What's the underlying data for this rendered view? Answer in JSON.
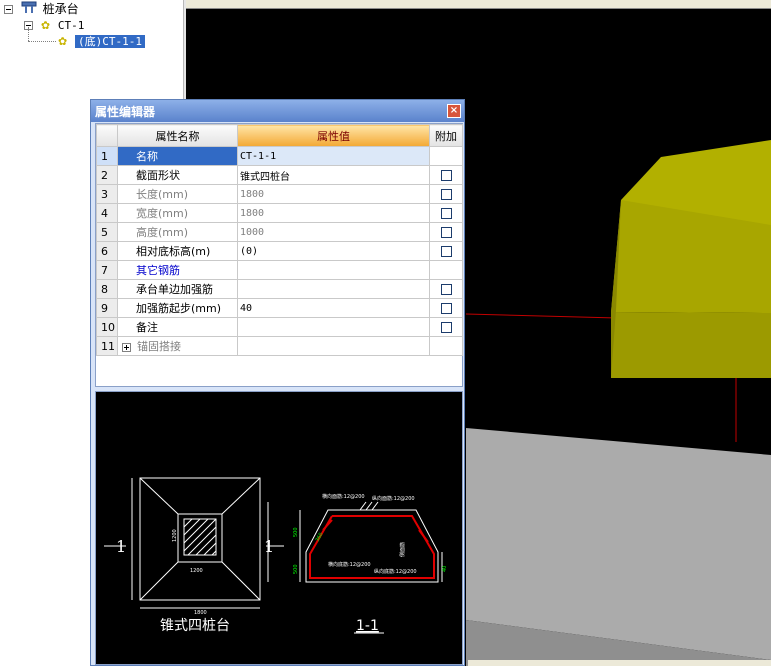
{
  "tree": {
    "root_label": "桩承台",
    "child_label": "CT-1",
    "leaf_label": "(底)CT-1-1"
  },
  "prop_editor": {
    "title": "属性编辑器",
    "close_glyph": "×",
    "columns": [
      "属性名称",
      "属性值",
      "附加"
    ],
    "rows": [
      {
        "num": "1",
        "name": "名称",
        "value": "CT-1-1",
        "checkbox": false,
        "gray": false,
        "selected": true
      },
      {
        "num": "2",
        "name": "截面形状",
        "value": "锥式四桩台",
        "checkbox": true
      },
      {
        "num": "3",
        "name": "长度(mm)",
        "value": "1800",
        "checkbox": true,
        "gray": true
      },
      {
        "num": "4",
        "name": "宽度(mm)",
        "value": "1800",
        "checkbox": true,
        "gray": true
      },
      {
        "num": "5",
        "name": "高度(mm)",
        "value": "1000",
        "checkbox": true,
        "gray": true
      },
      {
        "num": "6",
        "name": "相对底标高(m)",
        "value": "(0)",
        "checkbox": true
      },
      {
        "num": "7",
        "name": "其它钢筋",
        "value": "",
        "checkbox": false,
        "link": true
      },
      {
        "num": "8",
        "name": "承台单边加强筋",
        "value": "",
        "checkbox": true
      },
      {
        "num": "9",
        "name": "加强筋起步(mm)",
        "value": "40",
        "checkbox": true
      },
      {
        "num": "10",
        "name": "备注",
        "value": "",
        "checkbox": true
      },
      {
        "num": "11",
        "name": "锚固搭接",
        "value": "",
        "checkbox": false,
        "gray": true,
        "expandable": true
      }
    ]
  },
  "preview": {
    "plan_caption": "锥式四桩台",
    "section_caption": "1-1",
    "section_mark_left": "1",
    "section_mark_right": "1",
    "plan_inner_dim": "1200",
    "plan_side_dim": "1200",
    "plan_outer_dim": "1800",
    "label_top_h": "横向面筋:12@200",
    "label_top_v": "纵向面筋:12@200",
    "label_bot_h": "横向底筋:12@200",
    "label_bot_v": "纵向底筋:12@200",
    "label_side": "侧面筋",
    "label_h1": "500",
    "label_h2": "500",
    "label_slope": "360",
    "label_edge": "40"
  },
  "colors": {
    "block_face": "#9c9a00",
    "block_top": "#b2b000",
    "floor": "#ababab",
    "axis_red": "#c00000",
    "rebar_red": "#e00000",
    "dim_green": "#00ff00"
  }
}
